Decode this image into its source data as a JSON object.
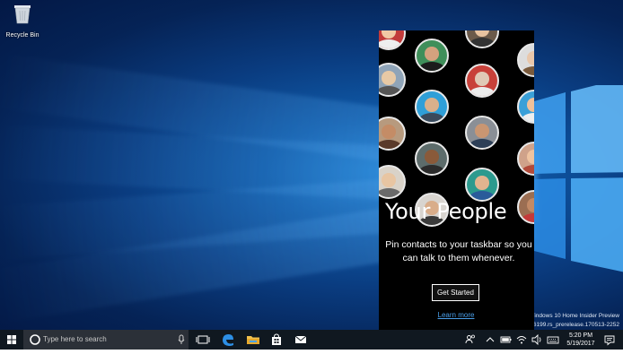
{
  "desktop": {
    "icons": [
      {
        "label": "Recycle Bin"
      }
    ],
    "watermark": {
      "line1": "Windows 10 Home Insider Preview",
      "line2": "16199.rs_prerelease.170513-2252"
    }
  },
  "people_panel": {
    "title": "Your People",
    "description": "Pin contacts to your taskbar so you can talk to them whenever.",
    "get_started_label": "Get Started",
    "learn_more_label": "Learn more"
  },
  "taskbar": {
    "search_placeholder": "Type here to search",
    "pinned_apps": [
      "task-view-icon",
      "edge-icon",
      "file-explorer-icon",
      "store-icon",
      "mail-icon"
    ],
    "tray_icons": [
      "people-icon",
      "chevron-up-icon",
      "battery-icon",
      "network-icon",
      "volume-icon",
      "keyboard-icon",
      "action-center-icon"
    ],
    "time": "5:20 PM",
    "date": "5/19/2017"
  },
  "colors": {
    "accent": "#0a5cad",
    "link": "#4a9ee8",
    "taskbar": "#101820",
    "panel": "#000000"
  }
}
